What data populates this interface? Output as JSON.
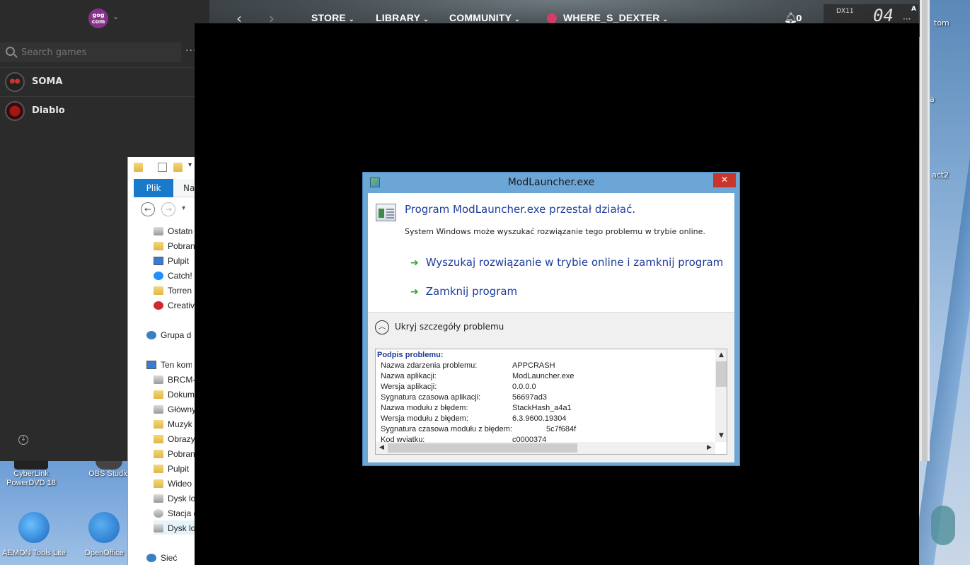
{
  "gog": {
    "logo_text": "gog\ncom",
    "search_placeholder": "Search games",
    "more": "···",
    "games": [
      {
        "name": "SOMA"
      },
      {
        "name": "Diablo"
      }
    ],
    "nav": {
      "store": "STORE",
      "library": "LIBRARY",
      "community": "COMMUNITY",
      "user": "WHERE_S_DEXTER",
      "notifications": "0"
    },
    "overlay": {
      "api": "DX11",
      "fps": "04",
      "badge": "A"
    }
  },
  "desktop": {
    "right_labels": [
      "tom",
      "a",
      "act2"
    ],
    "icons": [
      {
        "label": "CyberLink\nPowerDVD 18"
      },
      {
        "label": "OBS Studio"
      },
      {
        "label": "AEMON Tools Lite"
      },
      {
        "label": "OpenOffice"
      }
    ]
  },
  "explorer": {
    "tab_file": "Plik",
    "tab_next": "Nar",
    "tree": [
      {
        "label": "Ostatn",
        "icon": "recent-icon"
      },
      {
        "label": "Pobran",
        "icon": "folder-icon"
      },
      {
        "label": "Pulpit",
        "icon": "desktop-icon"
      },
      {
        "label": "Catch!",
        "icon": "bolt-icon"
      },
      {
        "label": "Torren",
        "icon": "folder-icon"
      },
      {
        "label": "Creativ",
        "icon": "creative-cloud-icon"
      },
      {
        "label": "Grupa do",
        "icon": "homegroup-icon"
      },
      {
        "label": "Ten kom",
        "icon": "computer-icon"
      },
      {
        "label": "BRCM-",
        "icon": "folder-icon"
      },
      {
        "label": "Dokum",
        "icon": "folder-icon"
      },
      {
        "label": "Główny",
        "icon": "folder-icon"
      },
      {
        "label": "Muzyk",
        "icon": "folder-icon"
      },
      {
        "label": "Obrazy",
        "icon": "folder-icon"
      },
      {
        "label": "Pobran",
        "icon": "folder-icon"
      },
      {
        "label": "Pulpit",
        "icon": "folder-icon"
      },
      {
        "label": "Wideo",
        "icon": "folder-icon"
      },
      {
        "label": "Dysk lo",
        "icon": "drive-icon"
      },
      {
        "label": "Stacja d",
        "icon": "disc-icon"
      },
      {
        "label": "Dysk lo",
        "icon": "drive-icon"
      },
      {
        "label": "Sieć",
        "icon": "network-icon"
      }
    ]
  },
  "dialog": {
    "title": "ModLauncher.exe",
    "close": "✕",
    "heading": "Program ModLauncher.exe przestał działać.",
    "subtext": "System Windows może wyszukać rozwiązanie tego problemu w trybie online.",
    "cmd_online": "Wyszukaj rozwiązanie w trybie online i zamknij program",
    "cmd_close": "Zamknij program",
    "details_toggle_label": "Ukryj szczegóły problemu",
    "details_header": "Podpis problemu:",
    "details": [
      {
        "key": "Nazwa zdarzenia problemu:",
        "value": "APPCRASH"
      },
      {
        "key": "Nazwa aplikacji:",
        "value": "ModLauncher.exe"
      },
      {
        "key": "Wersja aplikacji:",
        "value": "0.0.0.0"
      },
      {
        "key": "Sygnatura czasowa aplikacji:",
        "value": "56697ad3"
      },
      {
        "key": "Nazwa modułu z błędem:",
        "value": "StackHash_a4a1"
      },
      {
        "key": "Wersja modułu z błędem:",
        "value": "6.3.9600.19304"
      },
      {
        "key": "Sygnatura czasowa modułu z błędem:",
        "value": "5c7f684f"
      },
      {
        "key": "Kod wyjątku:",
        "value": "c0000374"
      }
    ]
  }
}
